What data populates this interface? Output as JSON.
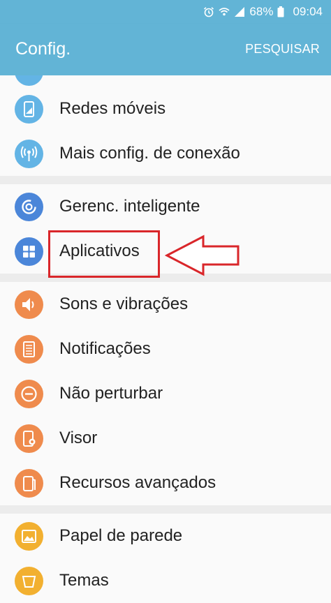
{
  "status_bar": {
    "battery": "68%",
    "time": "09:04",
    "icons": [
      "alarm-icon",
      "wifi-icon",
      "signal-icon",
      "battery-icon"
    ]
  },
  "app_bar": {
    "title": "Config.",
    "action": "PESQUISAR"
  },
  "groups": [
    {
      "items": [
        {
          "label": "Redes móveis",
          "icon": "mobile-network-icon",
          "color": "#63b4e5"
        },
        {
          "label": "Mais config. de conexão",
          "icon": "connection-icon",
          "color": "#63b4e5"
        }
      ]
    },
    {
      "items": [
        {
          "label": "Gerenc. inteligente",
          "icon": "smart-manager-icon",
          "color": "#4b86d9"
        },
        {
          "label": "Aplicativos",
          "icon": "apps-grid-icon",
          "color": "#4b86d9"
        }
      ]
    },
    {
      "items": [
        {
          "label": "Sons e vibrações",
          "icon": "speaker-icon",
          "color": "#ef8b4d"
        },
        {
          "label": "Notificações",
          "icon": "notification-icon",
          "color": "#ef8b4d"
        },
        {
          "label": "Não perturbar",
          "icon": "do-not-disturb-icon",
          "color": "#ef8b4d"
        },
        {
          "label": "Visor",
          "icon": "display-icon",
          "color": "#ef8b4d"
        },
        {
          "label": "Recursos avançados",
          "icon": "advanced-features-icon",
          "color": "#ef8b4d"
        }
      ]
    },
    {
      "items": [
        {
          "label": "Papel de parede",
          "icon": "wallpaper-icon",
          "color": "#f2b030"
        },
        {
          "label": "Temas",
          "icon": "themes-icon",
          "color": "#f2b030"
        }
      ]
    }
  ],
  "annotation": {
    "highlight_color": "#d9262a"
  }
}
